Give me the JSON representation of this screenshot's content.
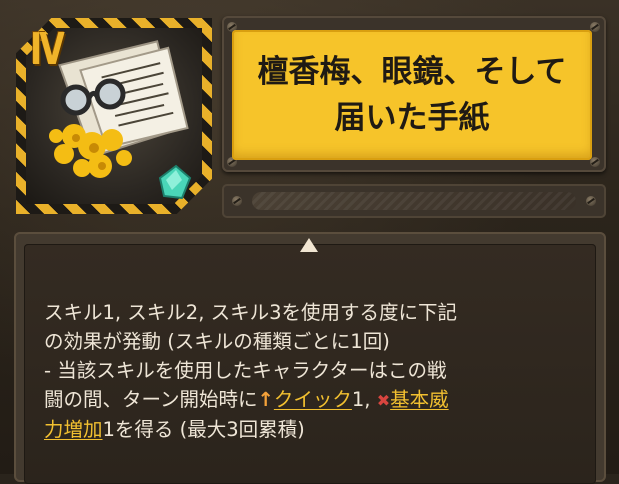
{
  "card": {
    "rank": "IV",
    "title": "檀香梅、眼鏡、そして届いた手紙"
  },
  "description": {
    "line1": "スキル1, スキル2, スキル3を使用する度に下記",
    "line2": "の効果が発動 (スキルの種類ごとに1回)",
    "line3": "- 当該スキルを使用したキャラクターはこの戦",
    "line4_a": "闘の間、ターン開始時に",
    "keyword1": "クイック",
    "line4_b": "1, ",
    "keyword2a": "基本威",
    "keyword2b": "力増加",
    "line5_b": "1を得る (最大3回累積)"
  },
  "icons": [
    "up-arrow-icon",
    "buff-icon",
    "expand-triangle-icon",
    "glasses-letter-artwork",
    "gem-icon"
  ],
  "colors": {
    "accent": "#f6c42a",
    "keyword": "#f2c030",
    "text": "#eee5d6"
  }
}
